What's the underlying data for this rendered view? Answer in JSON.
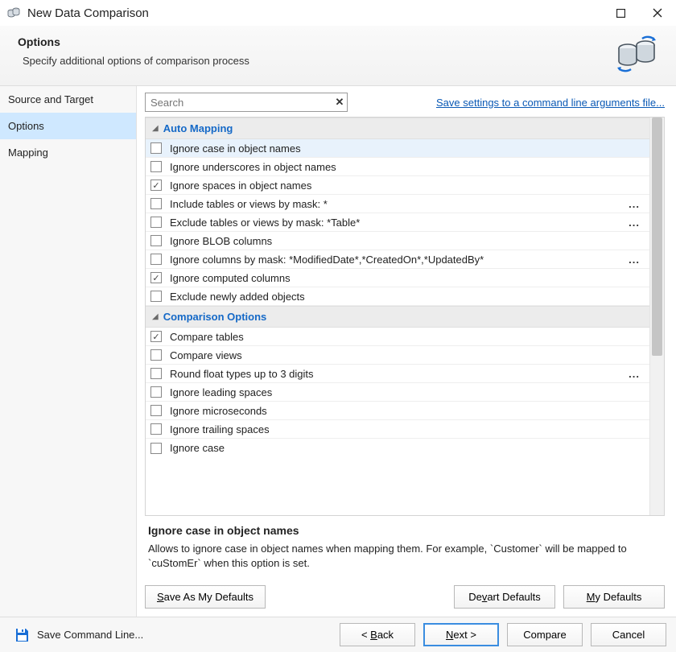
{
  "window": {
    "title": "New Data Comparison"
  },
  "header": {
    "title": "Options",
    "subtitle": "Specify additional options of comparison process"
  },
  "sidebar": {
    "items": [
      "Source and Target",
      "Options",
      "Mapping"
    ],
    "selected_index": 1
  },
  "search": {
    "placeholder": "Search"
  },
  "link": {
    "save_cmdline": "Save settings to a command line arguments file..."
  },
  "groups": [
    {
      "title": "Auto Mapping",
      "options": [
        {
          "label": "Ignore case in object names",
          "checked": false,
          "highlight": true
        },
        {
          "label": "Ignore underscores in object names",
          "checked": false
        },
        {
          "label": "Ignore spaces in object names",
          "checked": true
        },
        {
          "label": "Include tables or views by mask: *",
          "checked": false,
          "has_more": true
        },
        {
          "label": "Exclude tables or views by mask: *Table*",
          "checked": false,
          "has_more": true
        },
        {
          "label": "Ignore BLOB columns",
          "checked": false
        },
        {
          "label": "Ignore columns by mask: *ModifiedDate*,*CreatedOn*,*UpdatedBy*",
          "checked": false,
          "has_more": true
        },
        {
          "label": "Ignore computed columns",
          "checked": true
        },
        {
          "label": "Exclude newly added objects",
          "checked": false
        }
      ]
    },
    {
      "title": "Comparison Options",
      "options": [
        {
          "label": "Compare tables",
          "checked": true
        },
        {
          "label": "Compare views",
          "checked": false
        },
        {
          "label": "Round float types up to 3 digits",
          "checked": false,
          "has_more": true
        },
        {
          "label": "Ignore leading spaces",
          "checked": false
        },
        {
          "label": "Ignore microseconds",
          "checked": false
        },
        {
          "label": "Ignore trailing spaces",
          "checked": false
        },
        {
          "label": "Ignore case",
          "checked": false,
          "cut": true
        }
      ]
    }
  ],
  "description": {
    "title": "Ignore case in object names",
    "body": "Allows to ignore case in object names when mapping them. For example, `Customer` will be mapped to `cuStomEr` when this option is set."
  },
  "buttons": {
    "save_defaults": "Save As My Defaults",
    "devart_defaults": "Devart Defaults",
    "my_defaults": "My Defaults",
    "save_cmd_line": "Save Command Line...",
    "back": "< Back",
    "next": "Next >",
    "compare": "Compare",
    "cancel": "Cancel"
  }
}
